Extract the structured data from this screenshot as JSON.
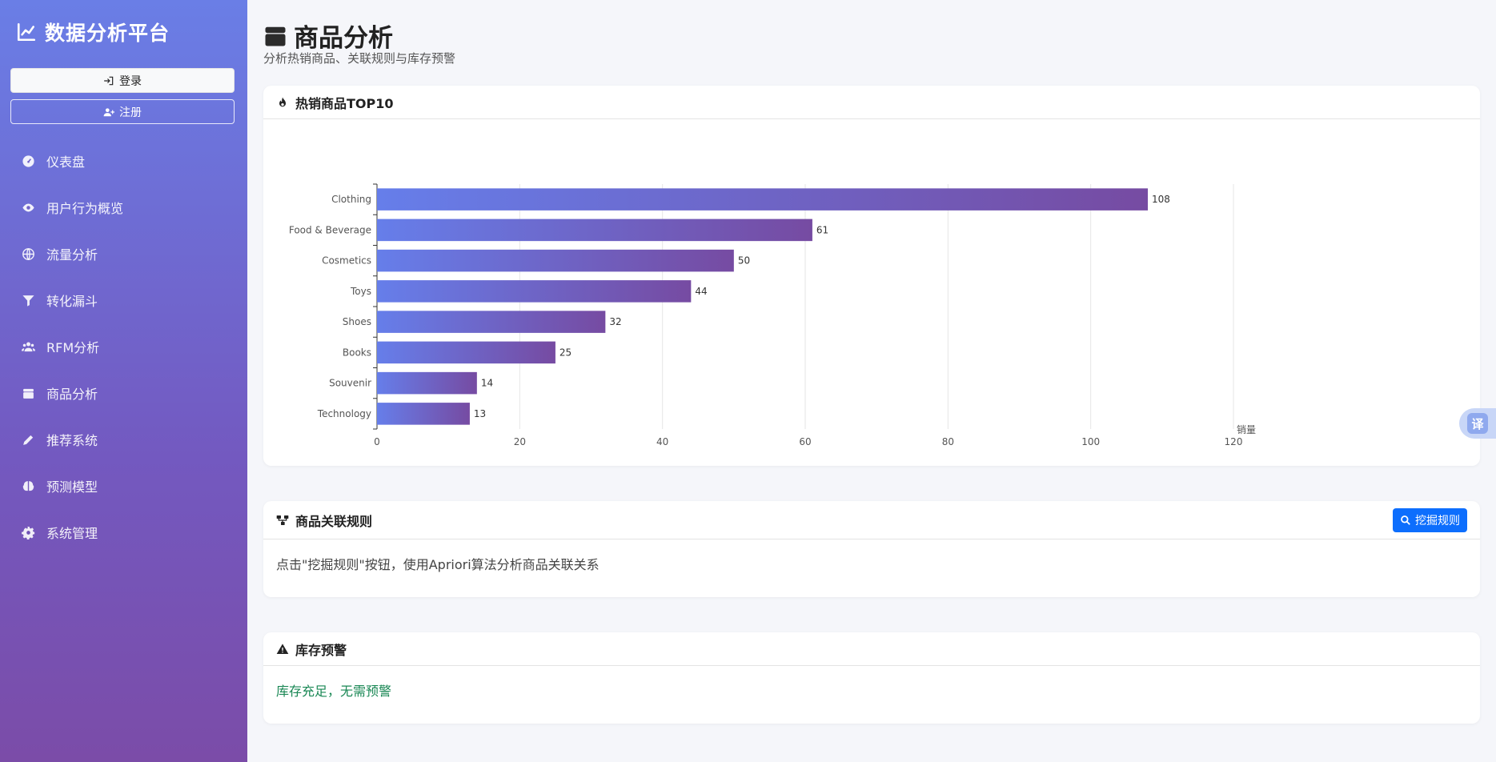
{
  "sidebar": {
    "brand": "数据分析平台",
    "login_label": "登录",
    "register_label": "注册",
    "items": [
      {
        "label": "仪表盘",
        "icon": "gauge-icon"
      },
      {
        "label": "用户行为概览",
        "icon": "eye-icon"
      },
      {
        "label": "流量分析",
        "icon": "globe-icon"
      },
      {
        "label": "转化漏斗",
        "icon": "filter-icon"
      },
      {
        "label": "RFM分析",
        "icon": "users-icon"
      },
      {
        "label": "商品分析",
        "icon": "box-icon"
      },
      {
        "label": "推荐系统",
        "icon": "pencil-icon"
      },
      {
        "label": "预测模型",
        "icon": "brain-icon"
      },
      {
        "label": "系统管理",
        "icon": "gear-icon"
      }
    ]
  },
  "page": {
    "title": "商品分析",
    "subtitle": "分析热销商品、关联规则与库存预警"
  },
  "top_products": {
    "title": "热销商品TOP10"
  },
  "rules": {
    "title": "商品关联规则",
    "mine_button": "挖掘规则",
    "hint": "点击\"挖掘规则\"按钮，使用Apriori算法分析商品关联关系"
  },
  "stock": {
    "title": "库存预警",
    "message": "库存充足，无需预警"
  },
  "translate_badge": "译",
  "colors": {
    "bar_start": "#667eea",
    "bar_end": "#764ba2",
    "primary_button": "#0d6efd",
    "success_text": "#198754"
  },
  "chart_data": {
    "type": "bar",
    "orientation": "horizontal",
    "categories": [
      "Clothing",
      "Food & Beverage",
      "Cosmetics",
      "Toys",
      "Shoes",
      "Books",
      "Souvenir",
      "Technology"
    ],
    "values": [
      108,
      61,
      50,
      44,
      32,
      25,
      14,
      13
    ],
    "xlabel": "销量",
    "xlim": [
      0,
      120
    ],
    "xticks": [
      0,
      20,
      40,
      60,
      80,
      100,
      120
    ],
    "grid": true
  }
}
